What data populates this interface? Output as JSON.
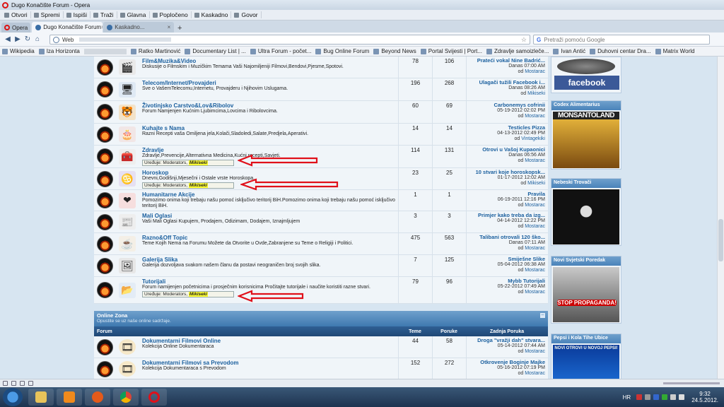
{
  "window": {
    "title": "Dugo Konačište Forum - Opera"
  },
  "menu": [
    "Otvori",
    "Spremi",
    "Ispiši",
    "Traži",
    "Glavna",
    "Popločeno",
    "Kaskadno",
    "Govor"
  ],
  "tabs": {
    "opera_label": "Opera",
    "active_label": "Dugo Konačište Forum",
    "inactive_label": "Kaskadno...",
    "new_tab": "+"
  },
  "address": {
    "scheme_label": "Web",
    "search_placeholder": "Pretraži pomoću Google"
  },
  "bookmarks": [
    "Wikipedia",
    "Iza Horizonta",
    "Ratko Martinović",
    "Documentary List | ...",
    "Ultra Forum - počet...",
    "Bug Online Forum",
    "Beyond News",
    "Portal Svijesti | Port...",
    "Zdravlje samoizleče...",
    "Ivan Antić",
    "Duhovni centar Dra...",
    "Matrix World"
  ],
  "forums": [
    {
      "title": "Film&Muzika&Video",
      "desc": "Diskusije o Filmskim i Muzičkim Temama Vaši Najomiljeniji Filmovi,Bendovi,Pjesme,Spotovi.",
      "topics": "78",
      "posts": "106",
      "last_title": "Prateći vokal Nine Badrić...",
      "last_time": "Danas 07:00 AM",
      "last_by": "od",
      "last_user": "Mostarac",
      "icon": "🎬",
      "icon_bg": "#e9e9e9"
    },
    {
      "title": "Telecom/Internet/Provajderi",
      "desc": "Sve o VašemTelecomu,Internetu, Provajderu i Njihovim Uslugama.",
      "topics": "196",
      "posts": "268",
      "last_title": "Ulagači tužili Facebook i...",
      "last_time": "Danas 08:26 AM",
      "last_by": "od",
      "last_user": "Mikiseki",
      "icon": "🖥",
      "icon_bg": "#dfe9f4"
    },
    {
      "title": "Životinjsko Carstvo&Lov&Ribolov",
      "desc": "Forum Namjenjen Kućnim Ljubimcima,Lovcima i Ribolovcima.",
      "topics": "60",
      "posts": "69",
      "last_title": "Carbonemys cofrinii",
      "last_time": "05-19-2012 02:02 PM",
      "last_by": "od",
      "last_user": "Mostarac",
      "icon": "🐯",
      "icon_bg": "#f2e3c9"
    },
    {
      "title": "Kuhajte s Nama",
      "desc": "Razni Recepti vaša Omiljena jela,Kolači,Sladoledi,Salate,Predjela,Aperativi.",
      "topics": "14",
      "posts": "14",
      "last_title": "Testicles Pizza",
      "last_time": "04-13-2012 02:49 PM",
      "last_by": "od",
      "last_user": "Vintagekiki",
      "icon": "🎂",
      "icon_bg": "#f1e6e6"
    },
    {
      "title": "Zdravlje",
      "desc": "Zdravlje,Prevencije,Alternativna Medicina,Kućni recepti,Savjeti.",
      "topics": "114",
      "posts": "131",
      "last_title": "Otrovi u Vašoj Kupaonici",
      "last_time": "Danas 06:56 AM",
      "last_by": "od",
      "last_user": "Mostarac",
      "icon": "🧰",
      "icon_bg": "#eeeeee",
      "mods_label": "Uređuje: Moderators,",
      "mods_user": "Mikiseki"
    },
    {
      "title": "Horoskop",
      "desc": "Dnevni,Godišnji,Mjesečni i Ostale vrste Horoskopa.",
      "topics": "23",
      "posts": "25",
      "last_title": "10 stvari koje horoskopsk...",
      "last_time": "01-17-2012 12:02 AM",
      "last_by": "od",
      "last_user": "Mikiseki",
      "icon": "♋",
      "icon_bg": "#e6e0f2",
      "mods_label": "Uređuje: Moderators,",
      "mods_user": "Mikiseki"
    },
    {
      "title": "Humanitarne Akcije",
      "desc": "Pomozimo onima koji trebaju našu pomoć isključivo teritorij BiH.Pomozimo onima koji trebaju našu pomoć isključivo teritorij BiH.",
      "topics": "1",
      "posts": "1",
      "last_title": "Pravila",
      "last_time": "06-19-2011 12:16 PM",
      "last_by": "od",
      "last_user": "Mostarac",
      "icon": "❤",
      "icon_bg": "#f6dede"
    },
    {
      "title": "Mali Oglasi",
      "desc": "Vaši Mali Oglasi Kupujem, Prodajem, Odizimam, Dodajem, Iznajmljujem",
      "topics": "3",
      "posts": "3",
      "last_title": "Primjer kako treba da izg...",
      "last_time": "04-14-2012 12:22 PM",
      "last_by": "od",
      "last_user": "Mostarac",
      "icon": "📰",
      "icon_bg": "#eeeeee"
    },
    {
      "title": "Razno&Off Topic",
      "desc": "Teme Kojih Nema na Forumu Možete da Otvorite u Ovde,Zabranjene su Teme o Religiji i Politici.",
      "topics": "475",
      "posts": "563",
      "last_title": "Talibani otrovali 120 ško...",
      "last_time": "Danas 07:11 AM",
      "last_by": "od",
      "last_user": "Mostarac",
      "icon": "☕",
      "icon_bg": "#f4efe6"
    },
    {
      "title": "Galerija Slika",
      "desc": "Galerija dozvoljava svakom našem članu da postavi neograničen broj svojih slika.",
      "topics": "7",
      "posts": "125",
      "last_title": "Smiješne Slike",
      "last_time": "05-04-2012 06:38 AM",
      "last_by": "od",
      "last_user": "Mostarac",
      "icon": "🖼",
      "icon_bg": "#e7e7e7"
    },
    {
      "title": "Tutorijali",
      "desc": "Forum namijenjen početnicima i prosječnim korisnicima Pročitajte tutorijale i naučite koristiti razne stvari.",
      "topics": "79",
      "posts": "96",
      "last_title": "Mybb Tutorijali",
      "last_time": "05-22-2012 07:49 AM",
      "last_by": "od",
      "last_user": "Mostarac",
      "icon": "📂",
      "icon_bg": "#e3ecf6",
      "mods_label": "Uređuje: Moderators,",
      "mods_user": "Mikiseki"
    }
  ],
  "online_zone": {
    "title": "Online Zona",
    "subtitle": "Opustite se uz naše online sadržaje.",
    "toggle": "–"
  },
  "headers": {
    "forum": "Forum",
    "topics": "Teme",
    "posts": "Poruke",
    "last": "Zadnja Poruka"
  },
  "online_forums": [
    {
      "title": "Dokumentarni Filmovi Online",
      "desc": "Kolekcija Online Dokumentaraca",
      "topics": "44",
      "posts": "58",
      "last_title": "Droga \"vražji dah\" stvara...",
      "last_time": "05-14-2012 07:44 AM",
      "last_by": "od",
      "last_user": "Mostarac"
    },
    {
      "title": "Dokumentarni Filmovi sa Prevodom",
      "desc": "Kolekcija Dokumentaraca s Prevodom",
      "topics": "152",
      "posts": "272",
      "last_title": "Otkrovenje Boginje Majke",
      "last_time": "05-16-2012 07:19 PM",
      "last_by": "od",
      "last_user": "Mostarac"
    }
  ],
  "sidebar": {
    "facebook_label": "facebook",
    "sections": [
      {
        "title": "Codex Alimentarius",
        "image_text": "MONSANTOLAND"
      },
      {
        "title": "Nebeski Trovači",
        "image_text": ""
      },
      {
        "title": "Novi Svjetski Poredak",
        "image_text": "STOP PROPAGANDA!"
      },
      {
        "title": "Pepsi i Kola Tihe Ubice",
        "image_text": "NOVI OTROVI U NOVOJ PEPSI!"
      }
    ]
  },
  "tray": {
    "lang": "HR",
    "time": "9:32",
    "date": "24.5.2012."
  },
  "colors": {
    "link": "#1a5f9e",
    "arrow": "#e0101a",
    "tab_header": "#2f5f93"
  }
}
